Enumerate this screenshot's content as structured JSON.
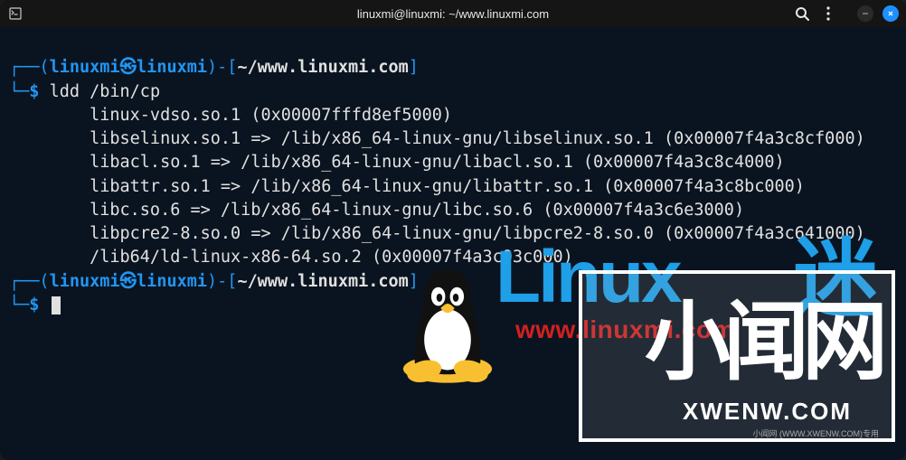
{
  "titlebar": {
    "title": "linuxmi@linuxmi: ~/www.linuxmi.com"
  },
  "prompt": {
    "user": "linuxmi",
    "host": "linuxmi",
    "path": "~/www.linuxmi.com",
    "symbol": "$"
  },
  "command": "ldd /bin/cp",
  "output_lines": [
    "        linux-vdso.so.1 (0x00007fffd8ef5000)",
    "        libselinux.so.1 => /lib/x86_64-linux-gnu/libselinux.so.1 (0x00007f4a3c8cf000)",
    "        libacl.so.1 => /lib/x86_64-linux-gnu/libacl.so.1 (0x00007f4a3c8c4000)",
    "        libattr.so.1 => /lib/x86_64-linux-gnu/libattr.so.1 (0x00007f4a3c8bc000)",
    "        libc.so.6 => /lib/x86_64-linux-gnu/libc.so.6 (0x00007f4a3c6e3000)",
    "        libpcre2-8.so.0 => /lib/x86_64-linux-gnu/libpcre2-8.so.0 (0x00007f4a3c641000)",
    "        /lib64/ld-linux-x86-64.so.2 (0x00007f4a3c93c000)"
  ],
  "watermark": {
    "linux_text": "Linux",
    "linux_url": "www.linuxmi.com",
    "mi_char": "迷",
    "xw_chars": "小闻网",
    "xw_url": "XWENW.COM",
    "xw_footer": "小闻网 (WWW.XWENW.COM)专用"
  }
}
